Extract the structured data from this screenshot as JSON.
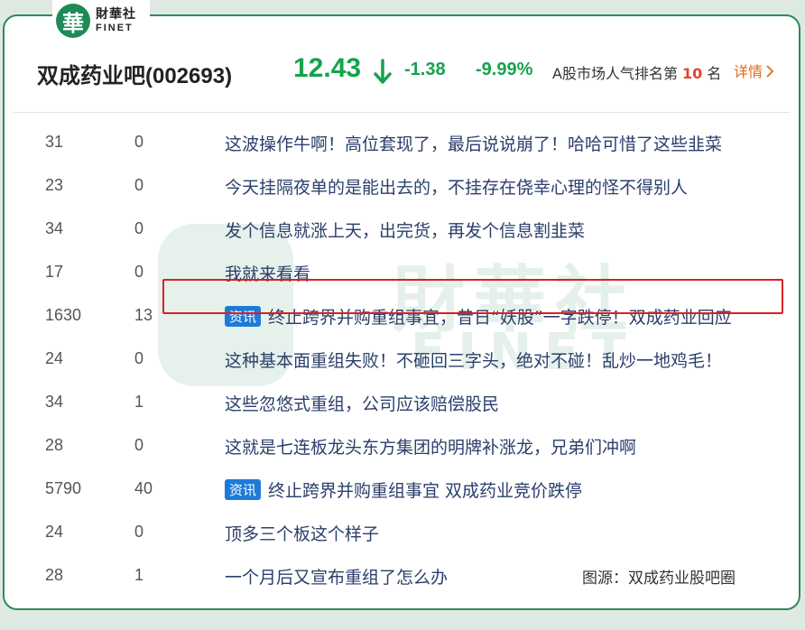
{
  "logo": {
    "mark": "華",
    "cn": "財華社",
    "en": "FINET"
  },
  "header": {
    "title": "双成药业吧(002693)",
    "price": "12.43",
    "change": "-1.38",
    "change_pct": "-9.99%",
    "rank_prefix": "A股市场人气排名第",
    "rank_num": "10",
    "rank_suffix": "名",
    "detail_label": "详情",
    "colors": {
      "down": "#16a34a",
      "rank": "#e0452b",
      "link": "#e06a1a",
      "brand": "#2f8a58",
      "tag": "#1e7ad8"
    }
  },
  "watermark": {
    "cn": "財華社",
    "en": "FINET"
  },
  "posts": [
    {
      "reads": "31",
      "replies": "0",
      "tag": "",
      "title": "这波操作牛啊！高位套现了，最后说说崩了！哈哈可惜了这些韭菜"
    },
    {
      "reads": "23",
      "replies": "0",
      "tag": "",
      "title": "今天挂隔夜单的是能出去的，不挂存在侥幸心理的怪不得别人"
    },
    {
      "reads": "34",
      "replies": "0",
      "tag": "",
      "title": "发个信息就涨上天，出完货，再发个信息割韭菜"
    },
    {
      "reads": "17",
      "replies": "0",
      "tag": "",
      "title": "我就来看看"
    },
    {
      "reads": "1630",
      "replies": "13",
      "tag": "资讯",
      "title": "终止跨界并购重组事宜，昔日“妖股”一字跌停！双成药业回应"
    },
    {
      "reads": "24",
      "replies": "0",
      "tag": "",
      "title": "这种基本面重组失败！不砸回三字头，绝对不碰！乱炒一地鸡毛！"
    },
    {
      "reads": "34",
      "replies": "1",
      "tag": "",
      "title": "这些忽悠式重组，公司应该赔偿股民",
      "highlighted": true
    },
    {
      "reads": "28",
      "replies": "0",
      "tag": "",
      "title": "这就是七连板龙头东方集团的明牌补涨龙，兄弟们冲啊"
    },
    {
      "reads": "5790",
      "replies": "40",
      "tag": "资讯",
      "title": "终止跨界并购重组事宜 双成药业竞价跌停"
    },
    {
      "reads": "24",
      "replies": "0",
      "tag": "",
      "title": "顶多三个板这个样子"
    },
    {
      "reads": "28",
      "replies": "1",
      "tag": "",
      "title": "一个月后又宣布重组了怎么办"
    }
  ],
  "source": "图源：双成药业股吧圈"
}
